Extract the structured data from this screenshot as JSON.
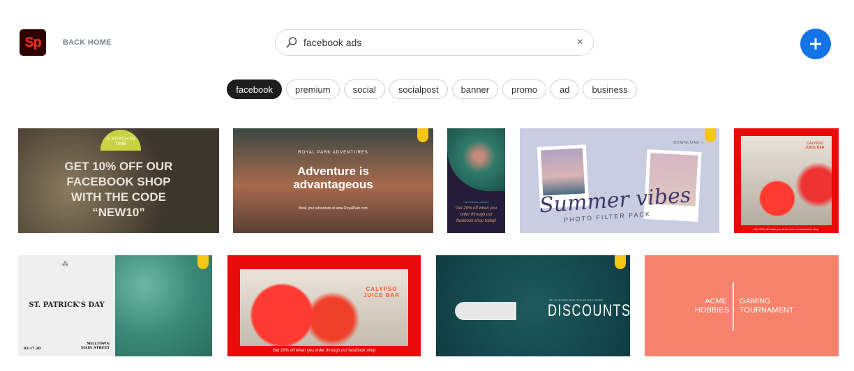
{
  "header": {
    "logo_text": "Sp",
    "back_home": "BACK HOME",
    "search_value": "facebook ads",
    "clear_icon": "×"
  },
  "accent": "#1473e6",
  "tags": [
    "facebook",
    "premium",
    "social",
    "socialpost",
    "banner",
    "promo",
    "ad",
    "business"
  ],
  "active_tag": "facebook",
  "templates": {
    "yarn": {
      "badge": "A STITCH IN TIME",
      "text": "GET 10% OFF OUR FACEBOOK SHOP WITH THE CODE “NEW10”"
    },
    "adventure": {
      "brand": "ROYAL PARK ADVENTURES",
      "title": "Adventure is advantageous",
      "footer": "Book your adventure at www.RoyalPark.com",
      "premium": true
    },
    "coffee": {
      "brand": "THE INTERIOR COMPANY",
      "text": "Get 20% off when you order through our facebook shop today!"
    },
    "summer": {
      "download": "DOWNLOAD »",
      "title": "Summer vibes",
      "subtitle": "PHOTO FILTER PACK",
      "premium": true
    },
    "juice_square": {
      "brand": "CALYPSO JUICE BAR",
      "footer": "Get 20% off when you order from our facebook shop"
    },
    "patrick": {
      "title": "ST. PATRICK'S DAY",
      "date": "03.17.20",
      "address_1": "MILLTOWN",
      "address_2": "MAIN STREET",
      "premium": true
    },
    "juice_banner": {
      "brand": "CALYPSO JUICE BAR",
      "footer": "Get 20% off when you order through our facebook shop"
    },
    "discounts": {
      "tagline": "Plan your destination ahead of time and receive incredible",
      "title": "DISCOUNTS",
      "premium": true
    },
    "gaming": {
      "left": "ACME HOBBIES",
      "right": "GAMING TOURNAMENT"
    }
  }
}
